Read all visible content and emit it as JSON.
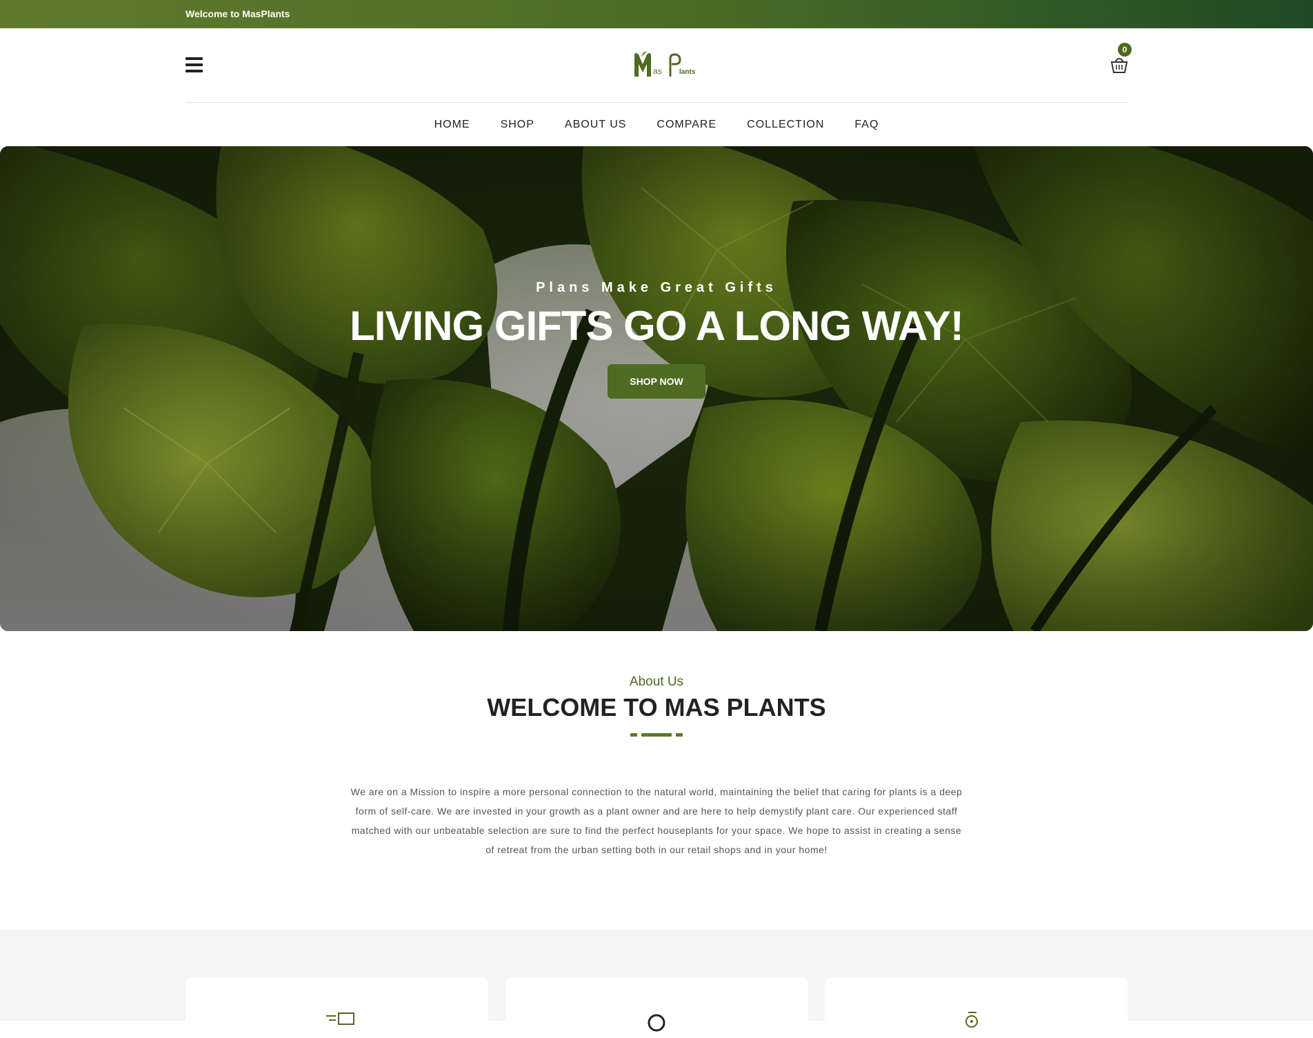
{
  "topbar": {
    "welcome": "Welcome to MasPlants"
  },
  "header": {
    "logo_text": "MasPlants",
    "cart_count": "0"
  },
  "nav": {
    "items": [
      "HOME",
      "SHOP",
      "ABOUT US",
      "COMPARE",
      "COLLECTION",
      "FAQ"
    ]
  },
  "hero": {
    "subtitle": "Plans Make Great Gifts",
    "title": "LIVING GIFTS GO A LONG WAY!",
    "button": "SHOP NOW"
  },
  "about": {
    "subtitle": "About Us",
    "title": "WELCOME TO MAS PLANTS",
    "text": "We are on a Mission to inspire a more personal connection to the natural world, maintaining the belief that caring for plants is a deep form of self-care. We are invested in your growth as a plant owner and are here to help demystify plant care. Our experienced staff matched with our unbeatable selection are sure to find the perfect houseplants for your space. We hope to assist in creating a sense of retreat from the urban setting both in our retail shops and in your home!"
  },
  "features": {
    "icons": [
      "delivery-truck-icon",
      "location-pin-icon",
      "support-agent-icon"
    ]
  },
  "colors": {
    "brand_green": "#4f6b21",
    "topbar_start": "#617a2c",
    "topbar_end": "#1f4a26",
    "section_bg": "#f5f5f5"
  }
}
